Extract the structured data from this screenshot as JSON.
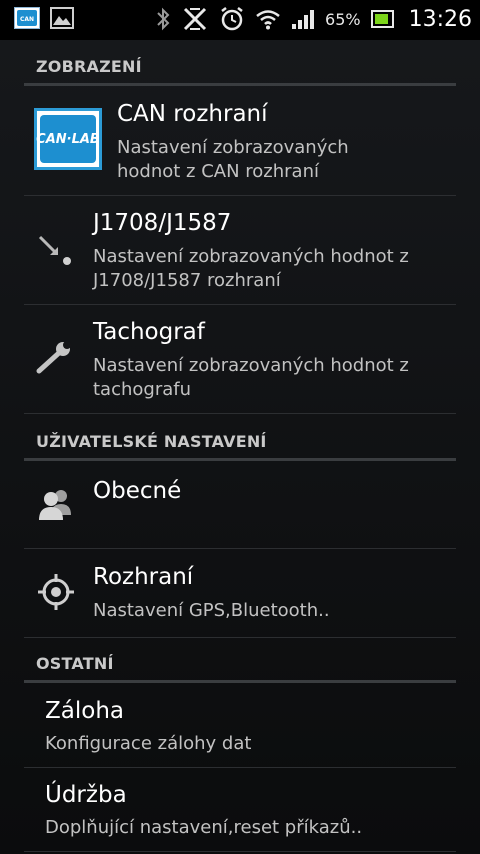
{
  "status_bar": {
    "battery_percent": "65%",
    "time": "13:26",
    "icons": [
      "canlab-app-icon",
      "image-icon",
      "bluetooth-icon",
      "no-sync-icon",
      "alarm-icon",
      "wifi-icon",
      "signal-icon",
      "battery-icon"
    ]
  },
  "sections": {
    "display": {
      "header": "ZOBRAZENÍ"
    },
    "user": {
      "header": "UŽIVATELSKÉ NASTAVENÍ"
    },
    "other": {
      "header": "OSTATNÍ"
    }
  },
  "items": {
    "can": {
      "title": "CAN rozhraní",
      "summary_line1": "Nastavení zobrazovaných",
      "summary_line2": "hodnot z CAN rozhraní",
      "logo_text": "CAN·LAB"
    },
    "j1708": {
      "title": "J1708/J1587",
      "summary_line1": "Nastavení zobrazovaných hodnot z",
      "summary_line2": "J1708/J1587 rozhraní"
    },
    "tacho": {
      "title": "Tachograf",
      "summary_line1": "Nastavení zobrazovaných hodnot z",
      "summary_line2": "tachografu"
    },
    "general": {
      "title": "Obecné"
    },
    "interface": {
      "title": "Rozhraní",
      "summary": "Nastavení GPS,Bluetooth.."
    },
    "backup": {
      "title": "Záloha",
      "summary": "Konfigurace zálohy dat"
    },
    "maintenance": {
      "title": "Údržba",
      "summary": "Doplňující nastavení,reset příkazů.."
    }
  }
}
